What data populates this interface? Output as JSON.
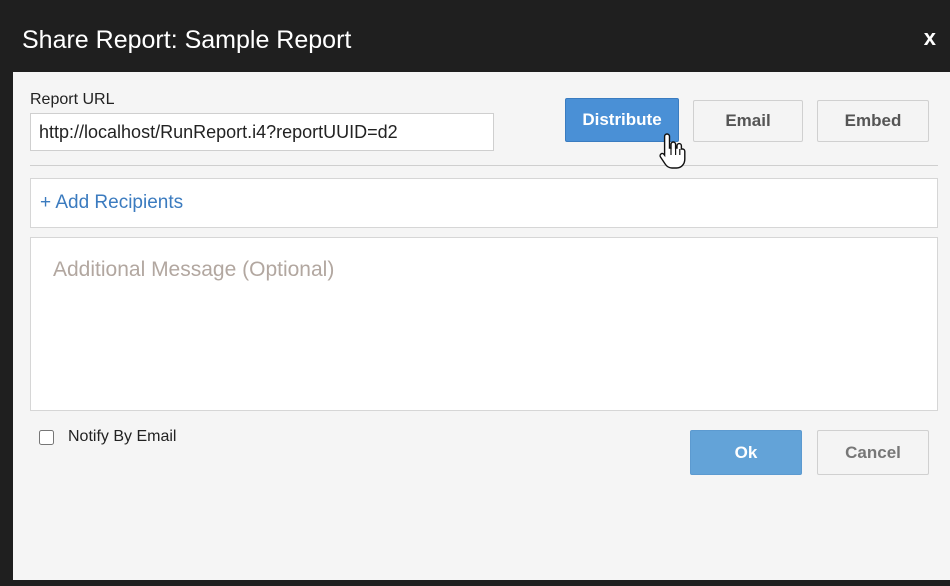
{
  "dialog": {
    "title": "Share Report: Sample Report",
    "close_label": "x"
  },
  "report_url": {
    "label": "Report URL",
    "value": "http://localhost/RunReport.i4?reportUUID=d2"
  },
  "share_modes": {
    "distribute_label": "Distribute",
    "email_label": "Email",
    "embed_label": "Embed",
    "active": "Distribute"
  },
  "recipients": {
    "add_label": "+ Add Recipients"
  },
  "message": {
    "placeholder": "Additional Message (Optional)",
    "value": ""
  },
  "notify": {
    "label": "Notify By Email",
    "checked": false
  },
  "footer": {
    "ok_label": "Ok",
    "cancel_label": "Cancel"
  },
  "colors": {
    "titlebar": "#1f1f1f",
    "primary_button": "#4a90d6",
    "link": "#3b7bbf"
  },
  "icons": {
    "cursor": "hand-pointer-icon"
  }
}
